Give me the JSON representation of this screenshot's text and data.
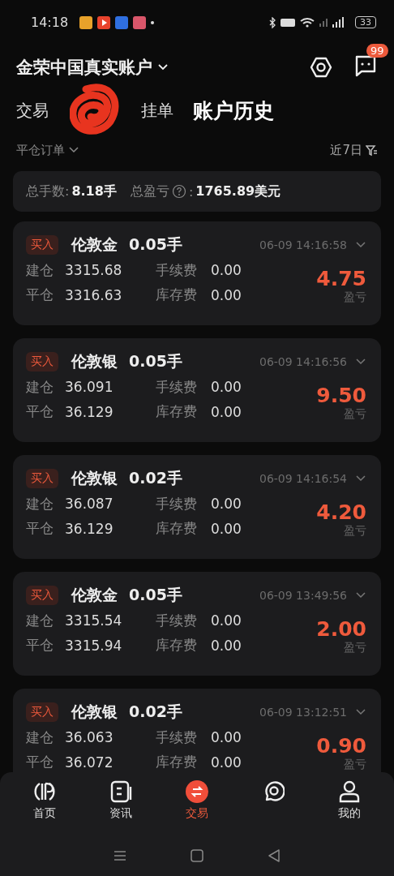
{
  "status_bar": {
    "time": "14:18",
    "battery": "33"
  },
  "header": {
    "account": "金荣中国真实账户",
    "badge": "99"
  },
  "tabs": [
    {
      "kind": "text",
      "label": "交易",
      "selected": false
    },
    {
      "kind": "redacted",
      "selected": false
    },
    {
      "kind": "text",
      "label": "挂单",
      "selected": false
    },
    {
      "kind": "text",
      "label": "账户历史",
      "selected": true
    }
  ],
  "filter": {
    "type": "平仓订单",
    "period": "近7日"
  },
  "summary": {
    "lots_label": "总手数:",
    "lots": "8.18手",
    "pnl_label": "总盈亏",
    "pnl_sep": ":",
    "pnl": "1765.89美元"
  },
  "orders": [
    {
      "side": "买入",
      "symbol": "伦敦金",
      "lots": "0.05手",
      "time": "06-09 14:16:58",
      "open_label": "建仓",
      "open": "3315.68",
      "close_label": "平仓",
      "close": "3316.63",
      "fee_label": "手续费",
      "fee": "0.00",
      "swap_label": "库存费",
      "swap": "0.00",
      "profit": "4.75",
      "profit_label": "盈亏"
    },
    {
      "side": "买入",
      "symbol": "伦敦银",
      "lots": "0.05手",
      "time": "06-09 14:16:56",
      "open_label": "建仓",
      "open": "36.091",
      "close_label": "平仓",
      "close": "36.129",
      "fee_label": "手续费",
      "fee": "0.00",
      "swap_label": "库存费",
      "swap": "0.00",
      "profit": "9.50",
      "profit_label": "盈亏"
    },
    {
      "side": "买入",
      "symbol": "伦敦银",
      "lots": "0.02手",
      "time": "06-09 14:16:54",
      "open_label": "建仓",
      "open": "36.087",
      "close_label": "平仓",
      "close": "36.129",
      "fee_label": "手续费",
      "fee": "0.00",
      "swap_label": "库存费",
      "swap": "0.00",
      "profit": "4.20",
      "profit_label": "盈亏"
    },
    {
      "side": "买入",
      "symbol": "伦敦金",
      "lots": "0.05手",
      "time": "06-09 13:49:56",
      "open_label": "建仓",
      "open": "3315.54",
      "close_label": "平仓",
      "close": "3315.94",
      "fee_label": "手续费",
      "fee": "0.00",
      "swap_label": "库存费",
      "swap": "0.00",
      "profit": "2.00",
      "profit_label": "盈亏"
    },
    {
      "side": "买入",
      "symbol": "伦敦银",
      "lots": "0.02手",
      "time": "06-09 13:12:51",
      "open_label": "建仓",
      "open": "36.063",
      "close_label": "平仓",
      "close": "36.072",
      "fee_label": "手续费",
      "fee": "0.00",
      "swap_label": "库存费",
      "swap": "0.00",
      "profit": "0.90",
      "profit_label": "盈亏"
    }
  ],
  "bottom_nav": [
    {
      "kind": "home",
      "label": "首页",
      "selected": false
    },
    {
      "kind": "news",
      "label": "资讯",
      "selected": false
    },
    {
      "kind": "trade",
      "label": "交易",
      "selected": true
    },
    {
      "kind": "chat",
      "selected": false
    },
    {
      "kind": "me",
      "label": "我的",
      "selected": false
    }
  ]
}
